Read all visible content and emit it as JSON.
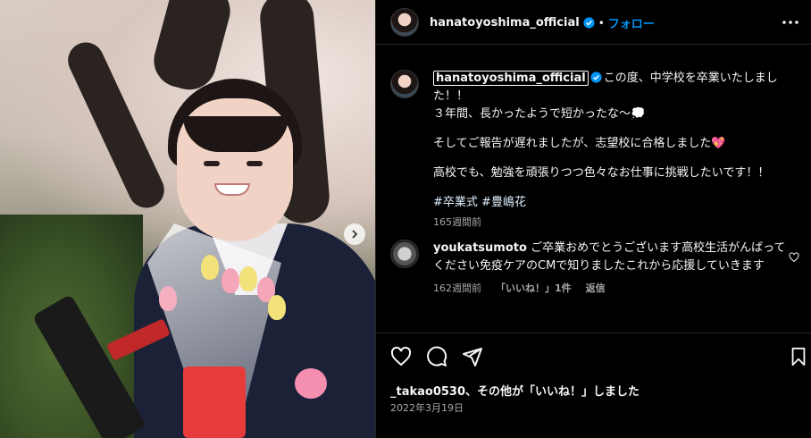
{
  "post": {
    "username": "hanatoyoshima_official",
    "follow_label": "フォロー",
    "separator": "•",
    "caption_lines": [
      "この度、中学校を卒業いたしました！！",
      "３年間、長かったようで短かったな〜💭",
      "そしてご報告が遅れましたが、志望校に合格しました💖",
      "高校でも、勉強を頑張りつつ色々なお仕事に挑戦したいです！！"
    ],
    "hashtags": [
      "#卒業式",
      "#豊嶋花"
    ],
    "caption_time": "165週間前",
    "likes_prefix": "_takao0530",
    "likes_suffix": "、その他が「いいね！」しました",
    "date": "2022年3月19日"
  },
  "comment": {
    "username": "youkatsumoto",
    "text": "ご卒業おめでとうございます高校生活がんばってください免疫ケアのCMで知りましたこれから応援していきます",
    "time": "162週間前",
    "likes": "「いいね！」1件",
    "reply_label": "返信"
  },
  "icons": {
    "header_avatar": "avatar-icon",
    "verified": "verified-badge-icon",
    "more": "more-options-icon",
    "like": "heart-icon",
    "comment": "comment-icon",
    "share": "share-icon",
    "save": "bookmark-icon",
    "next": "chevron-right-icon"
  },
  "colors": {
    "background": "#000000",
    "accent": "#0095f6",
    "hashtag": "#e0f1ff",
    "muted": "#a8a8a8"
  }
}
